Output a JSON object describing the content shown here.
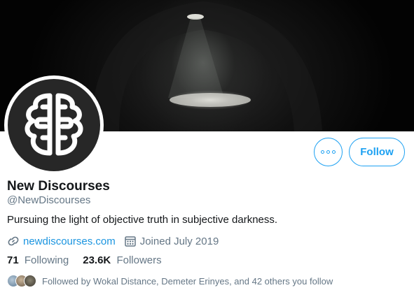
{
  "profile": {
    "name": "New Discourses",
    "handle": "@NewDiscourses",
    "bio": "Pursuing the light of objective truth in subjective darkness.",
    "website": "newdiscourses.com",
    "joined": "Joined July 2019"
  },
  "stats": {
    "following_count": "71",
    "following_label": "Following",
    "followers_count": "23.6K",
    "followers_label": "Followers"
  },
  "actions": {
    "follow_label": "Follow",
    "more_icon": "more-options-icon"
  },
  "followed_by": {
    "text": "Followed by Wokal Distance, Demeter Erinyes, and 42 others you follow"
  },
  "colors": {
    "accent": "#1da1f2",
    "link": "#1b95e0",
    "secondary_text": "#657786",
    "avatar_bg": "#272727"
  },
  "icons": {
    "website": "link-icon",
    "joined": "calendar-icon",
    "avatar": "brain-logo-icon"
  }
}
